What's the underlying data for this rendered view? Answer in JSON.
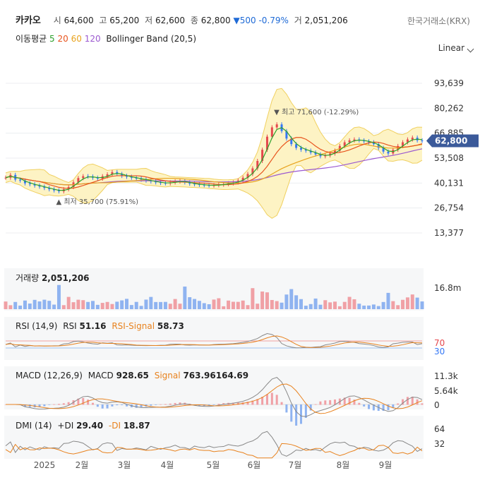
{
  "header": {
    "name": "카카오",
    "open_label": "시",
    "open": "64,600",
    "high_label": "고",
    "high": "65,200",
    "low_label": "저",
    "low": "62,600",
    "close_label": "종",
    "close": "62,800",
    "change": "▼500 -0.79%",
    "volume_label": "거",
    "volume": "2,051,206",
    "exchange": "한국거래소(KRX)"
  },
  "indicators": {
    "ma_label": "이동평균",
    "ma": [
      {
        "p": "5",
        "color": "#2ca02c"
      },
      {
        "p": "20",
        "color": "#e8541e"
      },
      {
        "p": "60",
        "color": "#e8a31e"
      },
      {
        "p": "120",
        "color": "#9b59d0"
      }
    ],
    "bb": "Bollinger Band (20,5)"
  },
  "scale_label": "Linear",
  "chart_data": [
    {
      "type": "line",
      "panel": "price",
      "y_ticks": [
        "93,639",
        "80,262",
        "66,885",
        "53,508",
        "40,131",
        "26,754",
        "13,377"
      ],
      "y_tick_values": [
        93639,
        80262,
        66885,
        53508,
        40131,
        26754,
        13377
      ],
      "current_price": "62,800",
      "x_ticks": [
        "2025",
        "2월",
        "3월",
        "4월",
        "5월",
        "6월",
        "7월",
        "8월",
        "9월"
      ],
      "annotations": {
        "high": "▼ 최고 71,600 (-12.29%)",
        "low": "▲ 최저 35,700 (75.91%)"
      },
      "close_series": [
        43000,
        44500,
        42000,
        41500,
        40000,
        39500,
        38800,
        38200,
        37500,
        36800,
        36200,
        35700,
        36800,
        38000,
        40500,
        42800,
        43800,
        43600,
        43000,
        42500,
        43800,
        44800,
        46000,
        45000,
        44000,
        43500,
        43000,
        42500,
        42000,
        41500,
        41000,
        40500,
        40200,
        40000,
        40500,
        41000,
        41200,
        40500,
        39800,
        39500,
        39200,
        39000,
        38800,
        39000,
        39300,
        39600,
        40000,
        40500,
        41500,
        43000,
        45000,
        48000,
        52000,
        58000,
        65000,
        70000,
        71600,
        68000,
        64000,
        61000,
        59000,
        58000,
        57500,
        56500,
        55500,
        54500,
        55000,
        56000,
        57500,
        60000,
        62000,
        63000,
        63500,
        63000,
        62500,
        62000,
        61000,
        59000,
        57000,
        56000,
        58000,
        60000,
        62000,
        63500,
        64500,
        63000,
        62800
      ],
      "colors": {
        "close": "#2ca02c",
        "ma20": "#e8541e",
        "ma60": "#e8a31e",
        "ma120": "#9b59d0",
        "band": "#fdf3c4",
        "band_edge": "#f0d060",
        "up": "#e5484d",
        "down": "#3478f6"
      }
    },
    {
      "type": "bar",
      "panel": "volume",
      "label": "거래량",
      "value": "2,051,206",
      "y_ticks": [
        "16.8m"
      ]
    },
    {
      "type": "line",
      "panel": "rsi",
      "label": "RSI (14,9)",
      "series": [
        {
          "name": "RSI",
          "value": "51.16"
        },
        {
          "name": "RSI-Signal",
          "value": "58.73"
        }
      ],
      "y_ticks": [
        "70",
        "30"
      ]
    },
    {
      "type": "line",
      "panel": "macd",
      "label": "MACD (12,26,9)",
      "series": [
        {
          "name": "MACD",
          "value": "928.65"
        },
        {
          "name": "Signal",
          "value": "763.96164.69"
        }
      ],
      "y_ticks": [
        "11.3k",
        "5.64k",
        "0"
      ]
    },
    {
      "type": "line",
      "panel": "dmi",
      "label": "DMI (14)",
      "series": [
        {
          "name": "+DI",
          "value": "29.40"
        },
        {
          "name": "-DI",
          "value": "18.87"
        }
      ],
      "y_ticks": [
        "64",
        "32"
      ]
    }
  ]
}
